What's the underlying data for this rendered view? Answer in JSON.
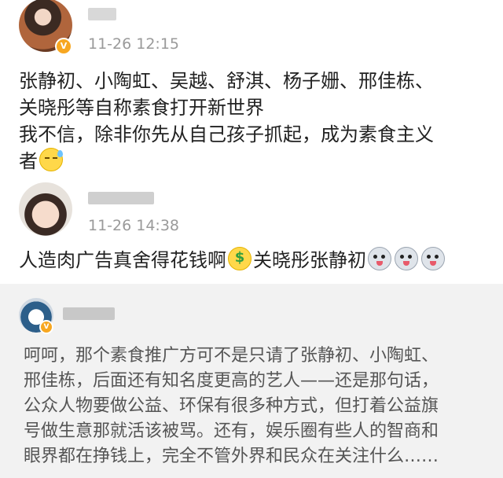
{
  "posts": [
    {
      "time": "11-26 12:15",
      "lines": [
        "张静初、小陶虹、吴越、舒淇、杨子姗、邢佳栋、",
        "关晓彤等自称素食打开新世界",
        "我不信，除非你先从自己孩子抓起，成为素食主义",
        "者"
      ],
      "emoji_after_last": "sweat-emoji"
    },
    {
      "time": "11-26 14:38",
      "text_before": "人造肉广告真舍得花钱啊",
      "text_after": "关晓彤张静初",
      "emojis_after": [
        "husky-emoji",
        "husky-emoji",
        "husky-emoji"
      ]
    }
  ],
  "reply": {
    "lines": [
      "呵呵，那个素食推广方可不是只请了张静初、小陶虹、",
      "邢佳栋，后面还有知名度更高的艺人——还是那句话，",
      "公众人物要做公益、环保有很多种方式，但打着公益旗",
      "号做生意那就活该被骂。还有，娱乐圈有些人的智商和",
      "眼界都在挣钱上，完全不管外界和民众在关注什么……"
    ]
  },
  "colors": {
    "time": "#9a9a9a",
    "reply_bg": "#f2f2f2",
    "verified_badge": "#f7a721"
  }
}
